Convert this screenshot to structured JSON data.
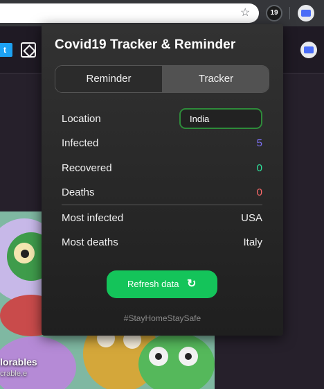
{
  "browser": {
    "star_icon": "☆",
    "extension_badge": "19",
    "twitter_glyph": "t"
  },
  "page": {
    "art_caption": "lorables",
    "art_subcaption": "crable.e"
  },
  "popup": {
    "title": "Covid19 Tracker & Reminder",
    "tabs": [
      {
        "label": "Reminder",
        "active": false
      },
      {
        "label": "Tracker",
        "active": true
      }
    ],
    "location": {
      "label": "Location",
      "value": "India"
    },
    "stats": [
      {
        "label": "Infected",
        "value": "5",
        "color": "#7b6ff0"
      },
      {
        "label": "Recovered",
        "value": "0",
        "color": "#2ee59d"
      },
      {
        "label": "Deaths",
        "value": "0",
        "color": "#ff6b6b"
      }
    ],
    "summary": [
      {
        "label": "Most infected",
        "value": "USA"
      },
      {
        "label": "Most deaths",
        "value": "Italy"
      }
    ],
    "refresh_button": {
      "label": "Refresh data",
      "icon": "↻"
    },
    "footer": "#StayHomeStaySafe"
  },
  "colors": {
    "accent_green": "#14c45a",
    "input_border": "#2e8b3a",
    "active_tab": "#525252"
  }
}
